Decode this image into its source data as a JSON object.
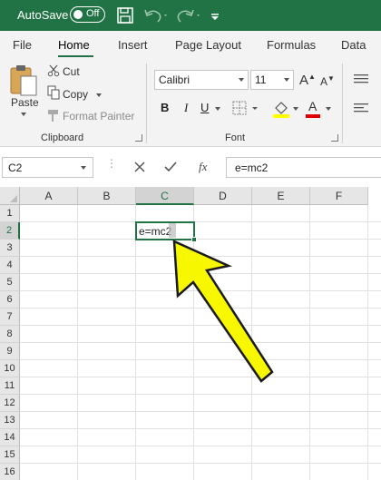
{
  "titlebar": {
    "autosave_label": "AutoSave",
    "toggle_state": "Off",
    "bg_color": "#217346"
  },
  "tabs": [
    {
      "label": "File"
    },
    {
      "label": "Home",
      "active": true
    },
    {
      "label": "Insert"
    },
    {
      "label": "Page Layout"
    },
    {
      "label": "Formulas"
    },
    {
      "label": "Data"
    }
  ],
  "clipboard": {
    "paste_label": "Paste",
    "cut_label": "Cut",
    "copy_label": "Copy",
    "format_painter_label": "Format Painter",
    "group_label": "Clipboard"
  },
  "font": {
    "family_value": "Calibri",
    "size_value": "11",
    "bold": "B",
    "italic": "I",
    "underline": "U",
    "font_color_letter": "A",
    "font_color": "#e00000",
    "highlight_color": "#ffff00",
    "group_label": "Font"
  },
  "formula_bar": {
    "name_box": "C2",
    "fx": "fx",
    "formula": "e=mc2"
  },
  "grid": {
    "columns": [
      "A",
      "B",
      "C",
      "D",
      "E",
      "F"
    ],
    "selected_column": "C",
    "rows": [
      "1",
      "2",
      "3",
      "4",
      "5",
      "6",
      "7",
      "8",
      "9",
      "10",
      "11",
      "12",
      "13",
      "14",
      "15",
      "16"
    ],
    "selected_row": "2",
    "active_cell": {
      "ref": "C2",
      "value": "e=mc2"
    }
  },
  "annotation": {
    "arrow_color": "#f7f700"
  }
}
